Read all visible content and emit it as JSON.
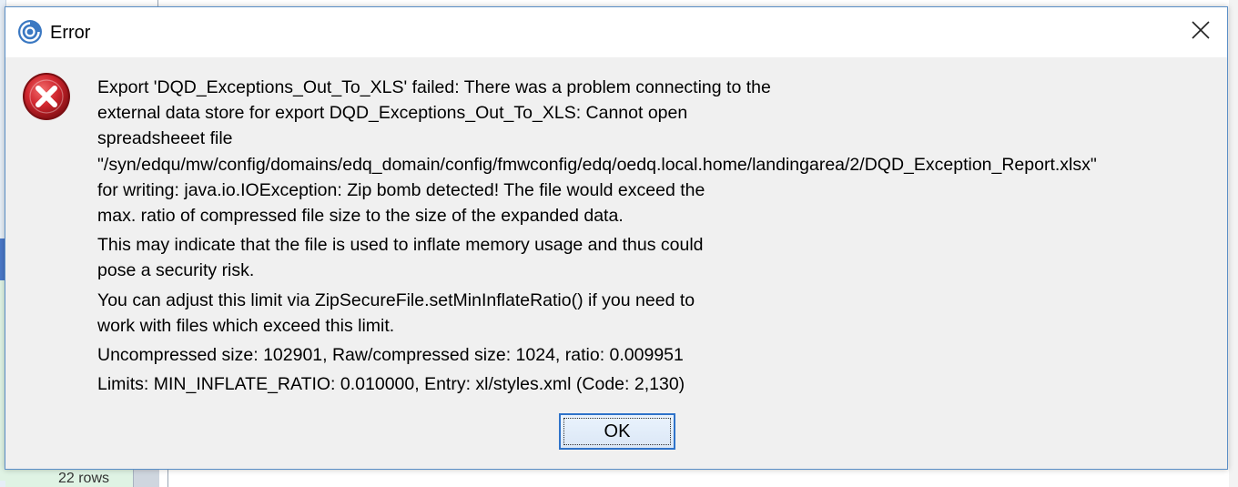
{
  "background": {
    "row_count": "22 rows"
  },
  "dialog": {
    "title": "Error",
    "icons": {
      "app": "app-logo-icon",
      "close": "close-icon",
      "error": "error-icon"
    },
    "message_lines": [
      "Export 'DQD_Exceptions_Out_To_XLS' failed: There was a problem connecting to the",
      "external data store for export DQD_Exceptions_Out_To_XLS: Cannot open",
      "spreadsheeet file",
      "\"/syn/edqu/mw/config/domains/edq_domain/config/fmwconfig/edq/oedq.local.home/landingarea/2/DQD_Exception_Report.xlsx\"",
      "for writing: java.io.IOException: Zip bomb detected! The file would exceed the",
      "max. ratio of compressed file size to the size of the expanded data.",
      "This may indicate that the file is used to inflate memory usage and thus could",
      "pose a security risk.",
      "You can adjust this limit via ZipSecureFile.setMinInflateRatio() if you need to",
      "work with files which exceed this limit.",
      "Uncompressed size: 102901, Raw/compressed size: 1024, ratio: 0.009951",
      "Limits: MIN_INFLATE_RATIO: 0.010000, Entry: xl/styles.xml (Code: 2,130)"
    ],
    "ok_label": "OK"
  },
  "colors": {
    "dialog_border": "#5b8fc7",
    "dialog_body": "#f0f0f0",
    "error_red": "#c8202a",
    "ok_border": "#2f73c9"
  }
}
